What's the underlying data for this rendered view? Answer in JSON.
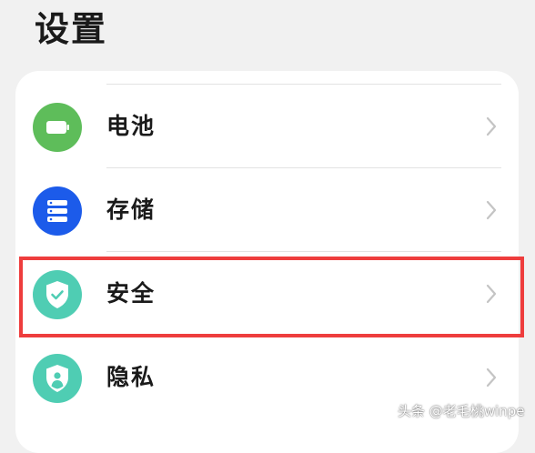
{
  "header": {
    "title": "设置"
  },
  "settings_list": {
    "items": [
      {
        "label": "电池",
        "icon": "battery-icon",
        "color": "#5ebd5a"
      },
      {
        "label": "存储",
        "icon": "storage-icon",
        "color": "#1c5bea"
      },
      {
        "label": "安全",
        "icon": "shield-icon",
        "color": "#4fcdb3"
      },
      {
        "label": "隐私",
        "icon": "privacy-icon",
        "color": "#4fcdb3"
      }
    ]
  },
  "highlight": {
    "target": "安全",
    "color": "#ee3d3d"
  },
  "watermark": {
    "text": "头条 @老毛桃winpe"
  }
}
